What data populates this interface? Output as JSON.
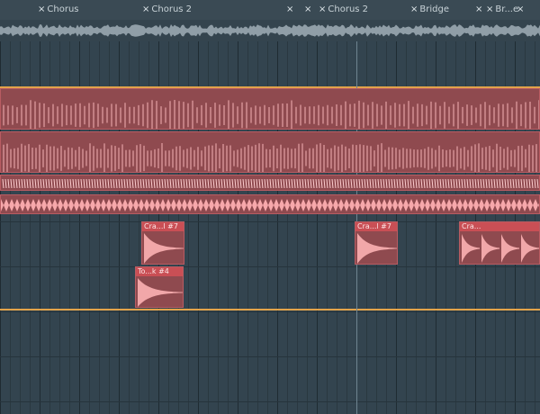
{
  "markers": [
    {
      "label": "Chorus",
      "x_icon": "×"
    },
    {
      "label": "Chorus 2",
      "x_icon": "×"
    },
    {
      "label": "",
      "x_icon": "×"
    },
    {
      "label": "",
      "x_icon": "×"
    },
    {
      "label": "Chorus 2",
      "x_icon": "×"
    },
    {
      "label": "Bridge",
      "x_icon": "×"
    },
    {
      "label": "",
      "x_icon": "×"
    },
    {
      "label": "Br...e",
      "x_icon": "×"
    },
    {
      "label": "",
      "x_icon": "×"
    }
  ],
  "shot_clips": [
    {
      "label": "Cra...l #7"
    },
    {
      "label": "To...k #4"
    },
    {
      "label": "Cra...l #7"
    },
    {
      "label": "Cra..."
    }
  ],
  "colors": {
    "background": "#334550",
    "clip_fill": "#8f4a4f",
    "clip_header": "#c94f55",
    "waveform": "#f1a7a9",
    "loop_marker": "#e3a34a"
  }
}
